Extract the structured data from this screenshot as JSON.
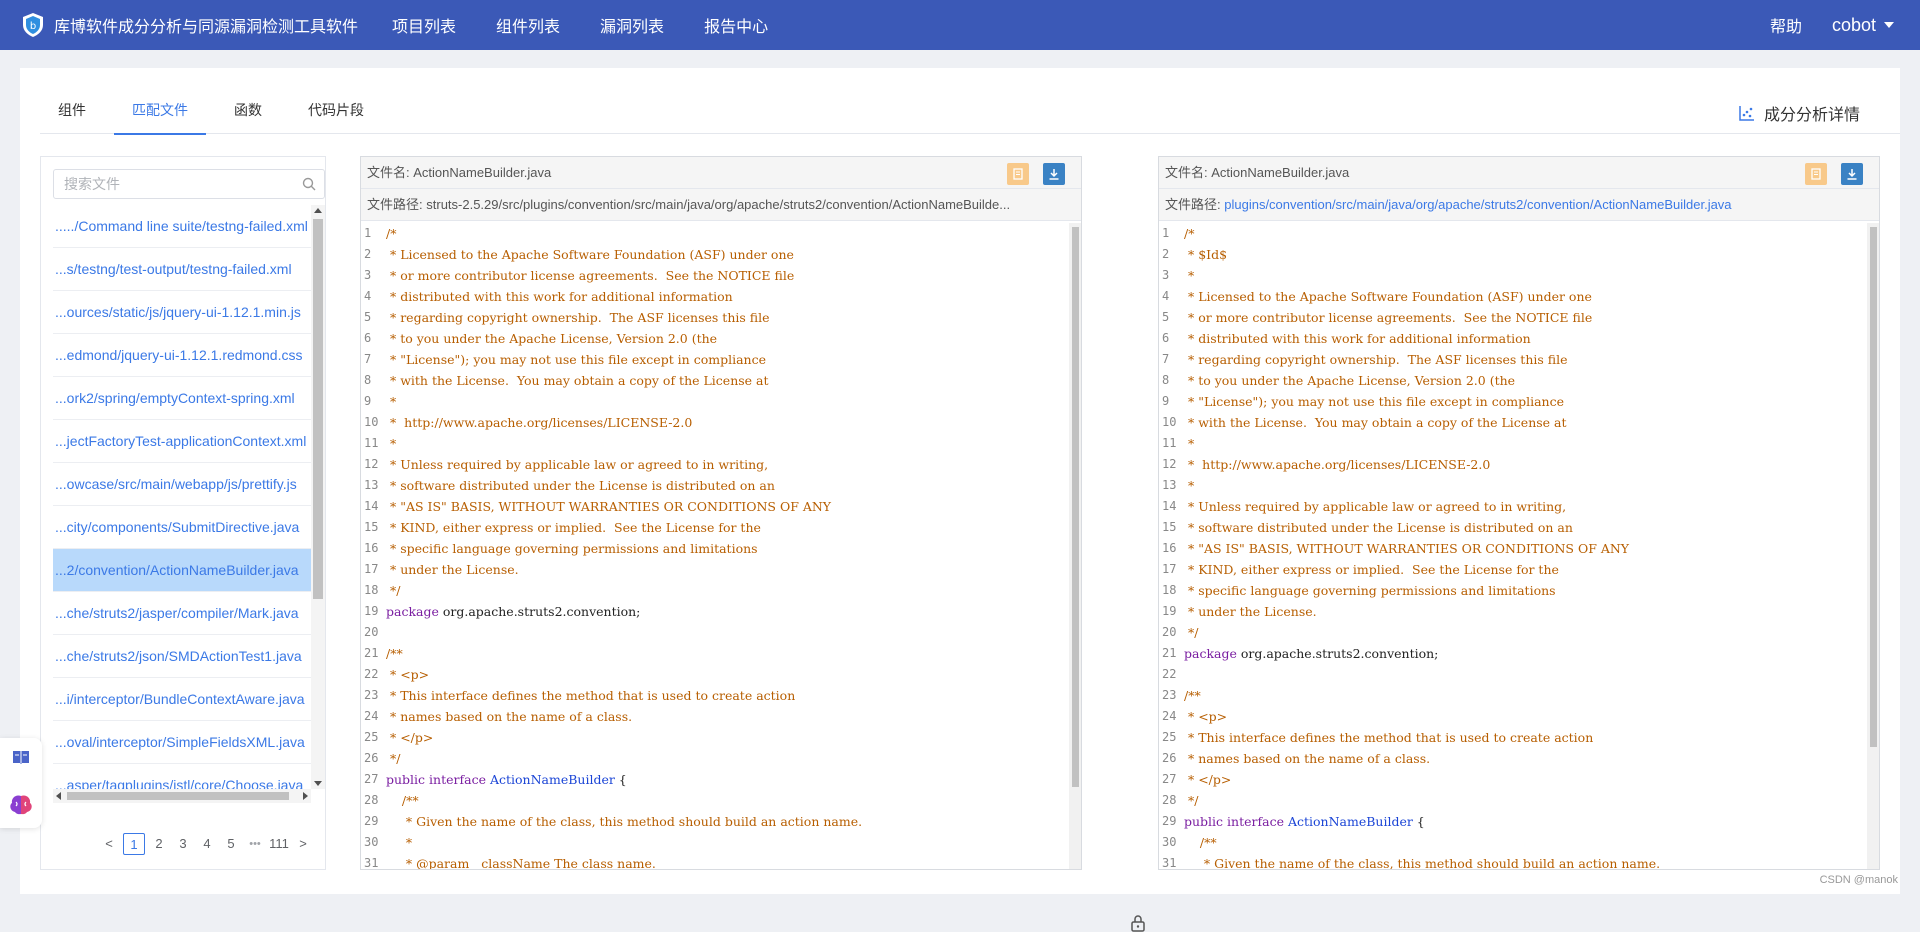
{
  "app": {
    "title": "库博软件成分分析与同源漏洞检测工具软件",
    "nav": [
      "项目列表",
      "组件列表",
      "漏洞列表",
      "报告中心"
    ],
    "help": "帮助",
    "user": "cobot"
  },
  "tabs": [
    "组件",
    "匹配文件",
    "函数",
    "代码片段"
  ],
  "active_tab": "匹配文件",
  "analysis_link": "成分分析详情",
  "files": {
    "search_placeholder": "搜索文件",
    "items": [
      "...../Command line suite/testng-failed.xml",
      "...s/testng/test-output/testng-failed.xml",
      "...ources/static/js/jquery-ui-1.12.1.min.js",
      "...edmond/jquery-ui-1.12.1.redmond.css",
      "...ork2/spring/emptyContext-spring.xml",
      "...jectFactoryTest-applicationContext.xml",
      "...owcase/src/main/webapp/js/prettify.js",
      "...city/components/SubmitDirective.java",
      "...2/convention/ActionNameBuilder.java",
      "...che/struts2/jasper/compiler/Mark.java",
      "...che/struts2/json/SMDActionTest1.java",
      "...i/interceptor/BundleContextAware.java",
      "...oval/interceptor/SimpleFieldsXML.java",
      "...asper/tagplugins/jstl/core/Choose.java"
    ],
    "selected_index": 8,
    "pager": {
      "prev": "<",
      "pages": [
        "1",
        "2",
        "3",
        "4",
        "5"
      ],
      "ellipsis": "•••",
      "last": "111",
      "next": ">",
      "current": "1"
    }
  },
  "left_panel": {
    "name_label": "文件名:",
    "name": "ActionNameBuilder.java",
    "path_label": "文件路径:",
    "path": "struts-2.5.29/src/plugins/convention/src/main/java/org/apache/struts2/convention/ActionNameBuilde..."
  },
  "right_panel": {
    "name_label": "文件名:",
    "name": "ActionNameBuilder.java",
    "path_label": "文件路径:",
    "path": "plugins/convention/src/main/java/org/apache/struts2/convention/ActionNameBuilder.java"
  },
  "left_code": [
    "/*",
    " * Licensed to the Apache Software Foundation (ASF) under one",
    " * or more contributor license agreements.  See the NOTICE file",
    " * distributed with this work for additional information",
    " * regarding copyright ownership.  The ASF licenses this file",
    " * to you under the Apache License, Version 2.0 (the",
    " * \"License\"); you may not use this file except in compliance",
    " * with the License.  You may obtain a copy of the License at",
    " *",
    " *  http://www.apache.org/licenses/LICENSE-2.0",
    " *",
    " * Unless required by applicable law or agreed to in writing,",
    " * software distributed under the License is distributed on an",
    " * \"AS IS\" BASIS, WITHOUT WARRANTIES OR CONDITIONS OF ANY",
    " * KIND, either express or implied.  See the License for the",
    " * specific language governing permissions and limitations",
    " * under the License.",
    " */",
    "package org.apache.struts2.convention;",
    "",
    "/**",
    " * <p>",
    " * This interface defines the method that is used to create action",
    " * names based on the name of a class.",
    " * </p>",
    " */",
    "public interface ActionNameBuilder {",
    "    /**",
    "     * Given the name of the class, this method should build an action name.",
    "     *",
    "     * @param   className The class name."
  ],
  "right_code": [
    "/*",
    " * $Id$",
    " *",
    " * Licensed to the Apache Software Foundation (ASF) under one",
    " * or more contributor license agreements.  See the NOTICE file",
    " * distributed with this work for additional information",
    " * regarding copyright ownership.  The ASF licenses this file",
    " * to you under the Apache License, Version 2.0 (the",
    " * \"License\"); you may not use this file except in compliance",
    " * with the License.  You may obtain a copy of the License at",
    " *",
    " *  http://www.apache.org/licenses/LICENSE-2.0",
    " *",
    " * Unless required by applicable law or agreed to in writing,",
    " * software distributed under the License is distributed on an",
    " * \"AS IS\" BASIS, WITHOUT WARRANTIES OR CONDITIONS OF ANY",
    " * KIND, either express or implied.  See the License for the",
    " * specific language governing permissions and limitations",
    " * under the License.",
    " */",
    "package org.apache.struts2.convention;",
    "",
    "/**",
    " * <p>",
    " * This interface defines the method that is used to create action",
    " * names based on the name of a class.",
    " * </p>",
    " */",
    "public interface ActionNameBuilder {",
    "    /**",
    "     * Given the name of the class, this method should build an action name."
  ],
  "colors": {
    "primary": "#3b59b7",
    "link": "#3b79e6",
    "comment": "#b75e00",
    "keyword": "#7a1ea1",
    "selected_row": "#b8d9fb"
  },
  "watermark": "CSDN @manok"
}
